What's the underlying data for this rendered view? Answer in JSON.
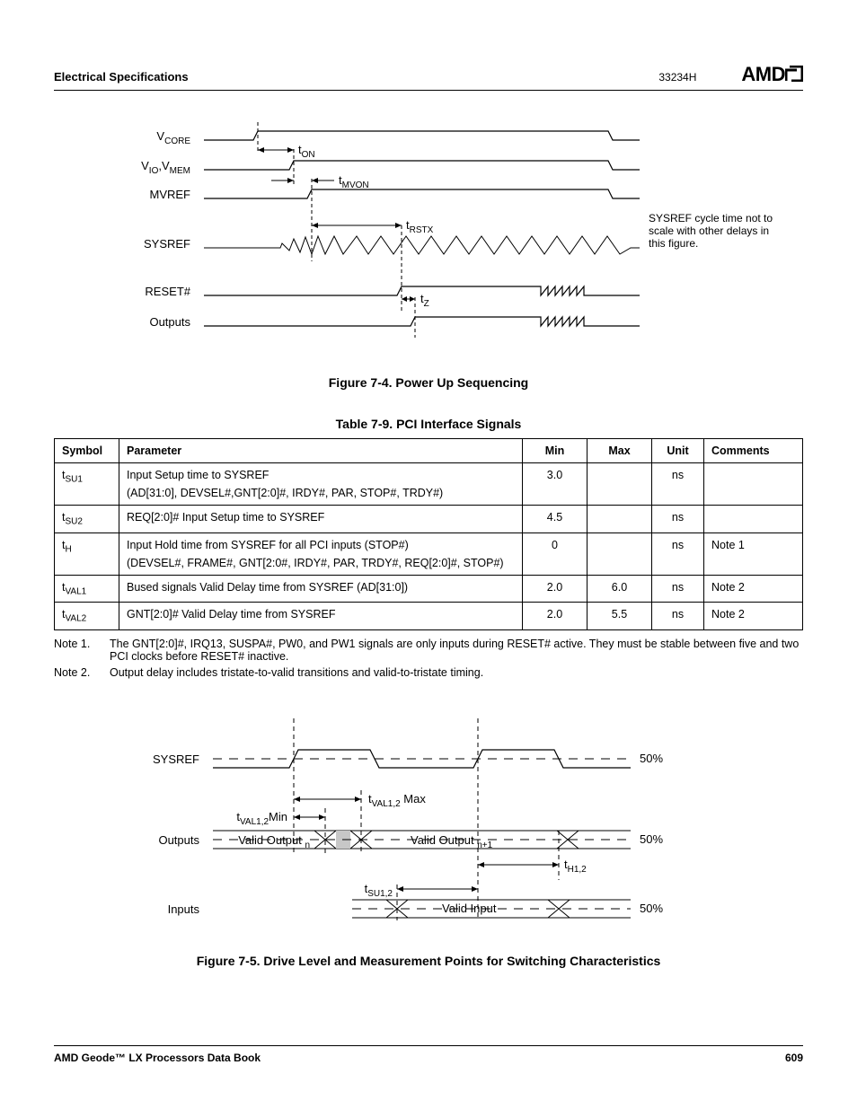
{
  "header": {
    "section": "Electrical Specifications",
    "doc_id": "33234H",
    "logo_text": "AMD"
  },
  "figure_7_4": {
    "caption": "Figure 7-4.  Power Up Sequencing",
    "labels": {
      "vcore": "V",
      "vcore_sub": "CORE",
      "vio": "V",
      "vio_sub": "IO",
      "vmem": "V",
      "vmem_sub": "MEM",
      "mvref": "MVREF",
      "sysref": "SYSREF",
      "reset": "RESET#",
      "outputs": "Outputs",
      "t_on": "t",
      "t_on_sub": "ON",
      "t_mvon": "t",
      "t_mvon_sub": "MVON",
      "t_rstx": "t",
      "t_rstx_sub": "RSTX",
      "t_z": "t",
      "t_z_sub": "Z",
      "side_note": "SYSREF cycle time not to scale with other delays in this figure."
    }
  },
  "table_7_9": {
    "caption": "Table 7-9.  PCI Interface Signals",
    "headers": {
      "symbol": "Symbol",
      "parameter": "Parameter",
      "min": "Min",
      "max": "Max",
      "unit": "Unit",
      "comments": "Comments"
    },
    "rows": [
      {
        "symbol_base": "t",
        "symbol_sub": "SU1",
        "parameter_a": "Input Setup time to SYSREF",
        "parameter_b": "(AD[31:0], DEVSEL#,GNT[2:0]#, IRDY#, PAR, STOP#, TRDY#)",
        "min": "3.0",
        "max": "",
        "unit": "ns",
        "comments": ""
      },
      {
        "symbol_base": "t",
        "symbol_sub": "SU2",
        "parameter_a": "REQ[2:0]# Input Setup time to SYSREF",
        "parameter_b": "",
        "min": "4.5",
        "max": "",
        "unit": "ns",
        "comments": ""
      },
      {
        "symbol_base": "t",
        "symbol_sub": "H",
        "parameter_a": "Input Hold time from SYSREF for all PCI inputs (STOP#)",
        "parameter_b": "(DEVSEL#, FRAME#, GNT[2:0#, IRDY#, PAR, TRDY#, REQ[2:0]#, STOP#)",
        "min": "0",
        "max": "",
        "unit": "ns",
        "comments": "Note 1"
      },
      {
        "symbol_base": "t",
        "symbol_sub": "VAL1",
        "parameter_a": "Bused signals Valid Delay time from SYSREF (AD[31:0])",
        "parameter_b": "",
        "min": "2.0",
        "max": "6.0",
        "unit": "ns",
        "comments": "Note 2"
      },
      {
        "symbol_base": "t",
        "symbol_sub": "VAL2",
        "parameter_a": "GNT[2:0]# Valid Delay time from SYSREF",
        "parameter_b": "",
        "min": "2.0",
        "max": "5.5",
        "unit": "ns",
        "comments": "Note 2"
      }
    ],
    "notes": [
      {
        "label": "Note 1.",
        "text": "The GNT[2:0]#, IRQ13, SUSPA#, PW0, and PW1 signals are only inputs during RESET# active. They must be stable between five and two PCI clocks before RESET# inactive."
      },
      {
        "label": "Note 2.",
        "text": "Output delay includes tristate-to-valid transitions and valid-to-tristate timing."
      }
    ]
  },
  "figure_7_5": {
    "caption": "Figure 7-5.  Drive Level and Measurement Points for Switching Characteristics",
    "labels": {
      "sysref": "SYSREF",
      "outputs": "Outputs",
      "inputs": "Inputs",
      "valid_output_n_a": "Valid Output",
      "valid_output_n_b": "n",
      "valid_output_n1_a": "Valid Output",
      "valid_output_n1_b": "n+1",
      "valid_input": "Valid Input",
      "t_val12_max_a": "t",
      "t_val12_max_b": "VAL1,2",
      "t_val12_max_c": " Max",
      "t_val12_min_a": "t",
      "t_val12_min_b": "VAL1,2",
      "t_val12_min_c": "Min",
      "t_su12_a": "t",
      "t_su12_b": "SU1,2",
      "t_h12_a": "t",
      "t_h12_b": "H1,2",
      "fifty": "50%"
    }
  },
  "footer": {
    "left": "AMD Geode™ LX Processors Data Book",
    "right": "609"
  }
}
